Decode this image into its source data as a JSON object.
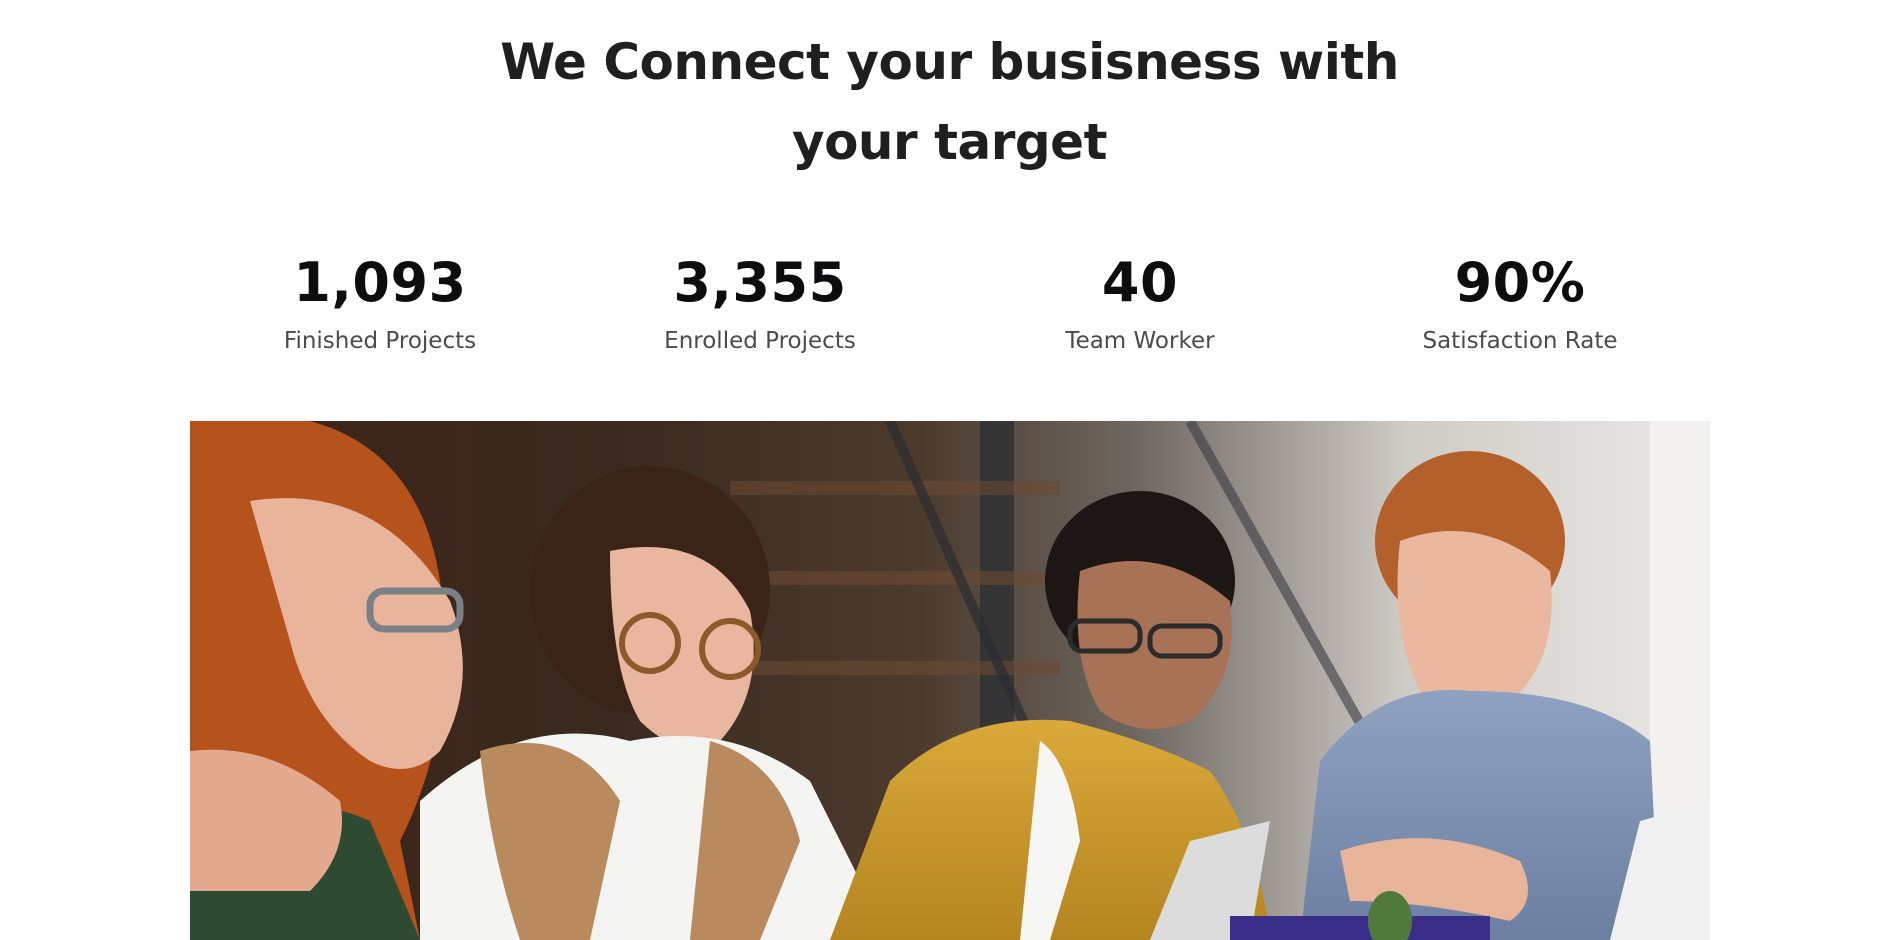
{
  "headline": {
    "line1": "We Connect your busisness with",
    "line2": "your target"
  },
  "stats": [
    {
      "value": "1,093",
      "label": "Finished Projects"
    },
    {
      "value": "3,355",
      "label": "Enrolled Projects"
    },
    {
      "value": "40",
      "label": "Team Worker"
    },
    {
      "value": "90%",
      "label": "Satisfaction Rate"
    }
  ],
  "photo": {
    "subject": "team-meeting-photo"
  }
}
